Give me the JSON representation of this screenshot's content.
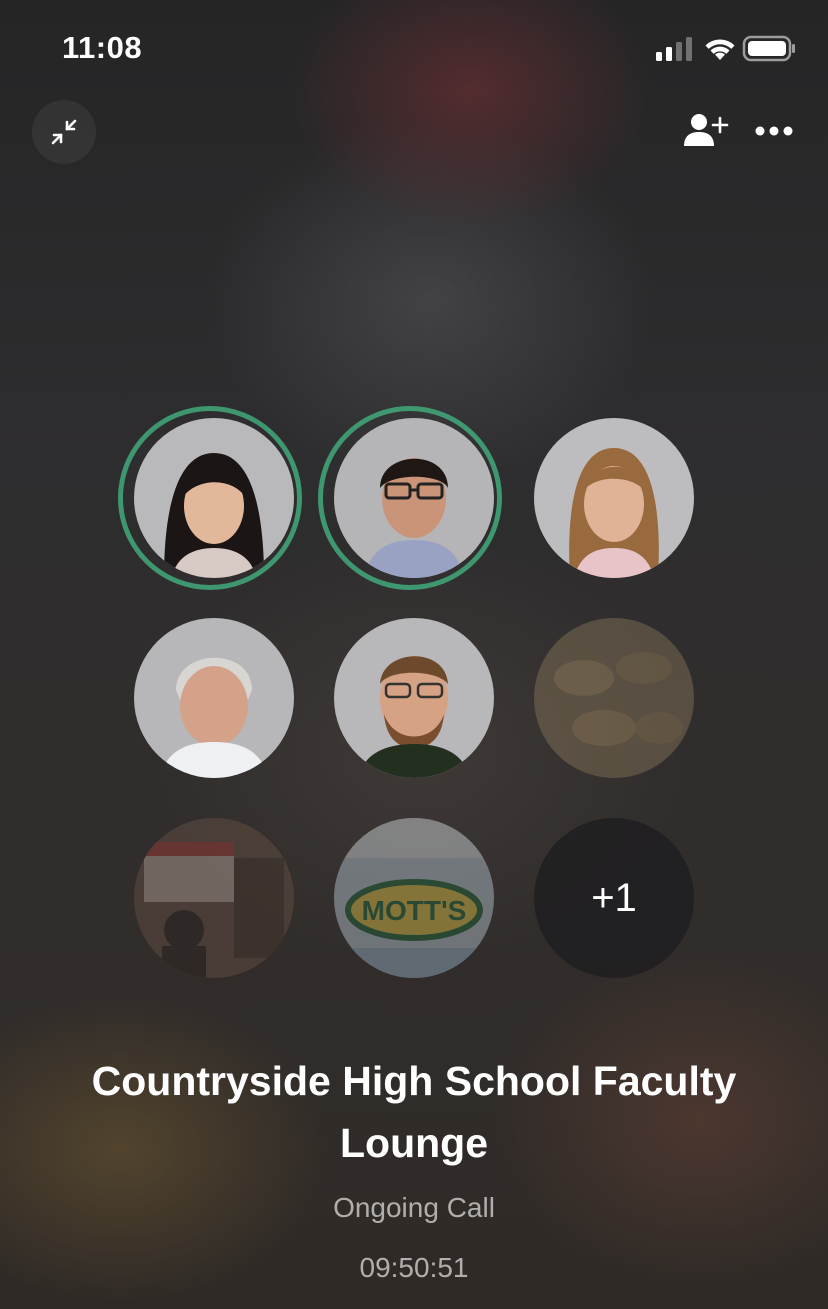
{
  "status_bar": {
    "time": "11:08",
    "icons": [
      "signal-icon",
      "wifi-icon",
      "battery-icon"
    ]
  },
  "top_bar": {
    "left_icon": "minimize-icon",
    "right_icons": [
      "add-user-icon",
      "more-options-icon"
    ]
  },
  "participants": {
    "speaking_ring_color": "#43b581",
    "tiles": [
      {
        "type": "photo",
        "speaking": true
      },
      {
        "type": "photo",
        "speaking": true
      },
      {
        "type": "photo",
        "speaking": false
      },
      {
        "type": "photo",
        "speaking": false
      },
      {
        "type": "photo",
        "speaking": false
      },
      {
        "type": "photo",
        "speaking": false,
        "dimmed": true
      },
      {
        "type": "photo",
        "speaking": false,
        "dimmed": true
      },
      {
        "type": "photo",
        "speaking": false,
        "dimmed": true,
        "label": "MOTT'S"
      }
    ],
    "overflow_label": "+1"
  },
  "call": {
    "title": "Countryside High School Faculty Lounge",
    "status": "Ongoing Call",
    "duration": "09:50:51"
  }
}
